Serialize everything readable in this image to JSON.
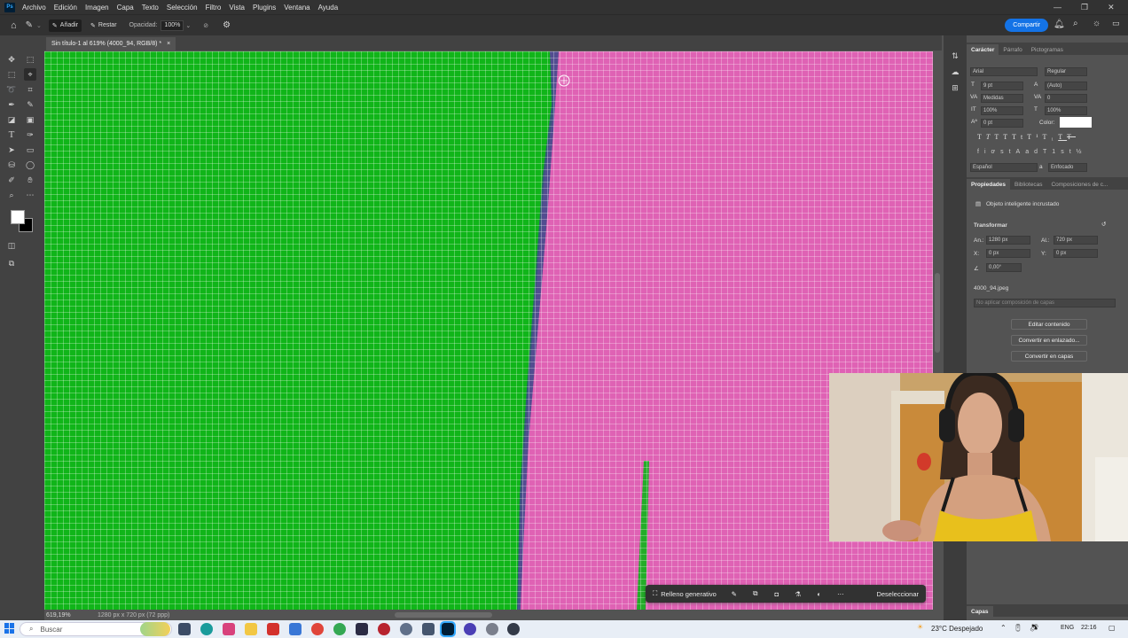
{
  "app": {
    "logo_text": "Ps"
  },
  "menu": [
    "Archivo",
    "Edición",
    "Imagen",
    "Capa",
    "Texto",
    "Selección",
    "Filtro",
    "Vista",
    "Plugins",
    "Ventana",
    "Ayuda"
  ],
  "options_bar": {
    "add_label": "Añadir",
    "subtract_label": "Restar",
    "opacity_label": "Opacidad:",
    "opacity_value": "100%",
    "share_label": "Compartir"
  },
  "document_tab": {
    "title": "Sin título-1 al 619% (4000_94, RGB/8) *",
    "close": "×"
  },
  "status": {
    "zoom": "619,19%",
    "doc_size": "1280 px x 720 px (72 ppp)"
  },
  "panels": {
    "character_tabs": [
      "Carácter",
      "Párrafo",
      "Pictogramas"
    ],
    "font_family": "Arial",
    "font_style": "Regular",
    "font_size": "9 pt",
    "leading": "(Auto)",
    "kerning": "Medidas",
    "tracking": "0",
    "vertical_scale": "100%",
    "horizontal_scale": "100%",
    "baseline": "0 pt",
    "color_label": "Color:",
    "language": "Español",
    "antialias": "Enfocado",
    "properties_tabs": [
      "Propiedades",
      "Bibliotecas",
      "Composiciones de c..."
    ],
    "object_type": "Objeto inteligente incrustado",
    "transform_heading": "Transformar",
    "width_label": "An.:",
    "width_value": "1280 px",
    "height_label": "Al.:",
    "height_value": "720 px",
    "x_label": "X:",
    "x_value": "0 px",
    "y_label": "Y:",
    "y_value": "0 px",
    "angle_value": "0,00°",
    "file_name": "4000_94.jpeg",
    "layer_comp": "No aplicar composición de capas",
    "edit_contents": "Editar contenido",
    "convert_linked": "Convertir en enlazado...",
    "convert_layers": "Convertir en capas",
    "layers_tab": "Capas"
  },
  "context_bar": {
    "generative_fill": "Relleno generativo",
    "deselect": "Deseleccionar"
  },
  "taskbar": {
    "search_placeholder": "Buscar",
    "weather": "23°C  Despejado",
    "lang": "ENG",
    "time": "22:16"
  },
  "colors": {
    "green_screen": "#10b519",
    "magenta": "#df62b4",
    "accent": "#1473e6"
  }
}
